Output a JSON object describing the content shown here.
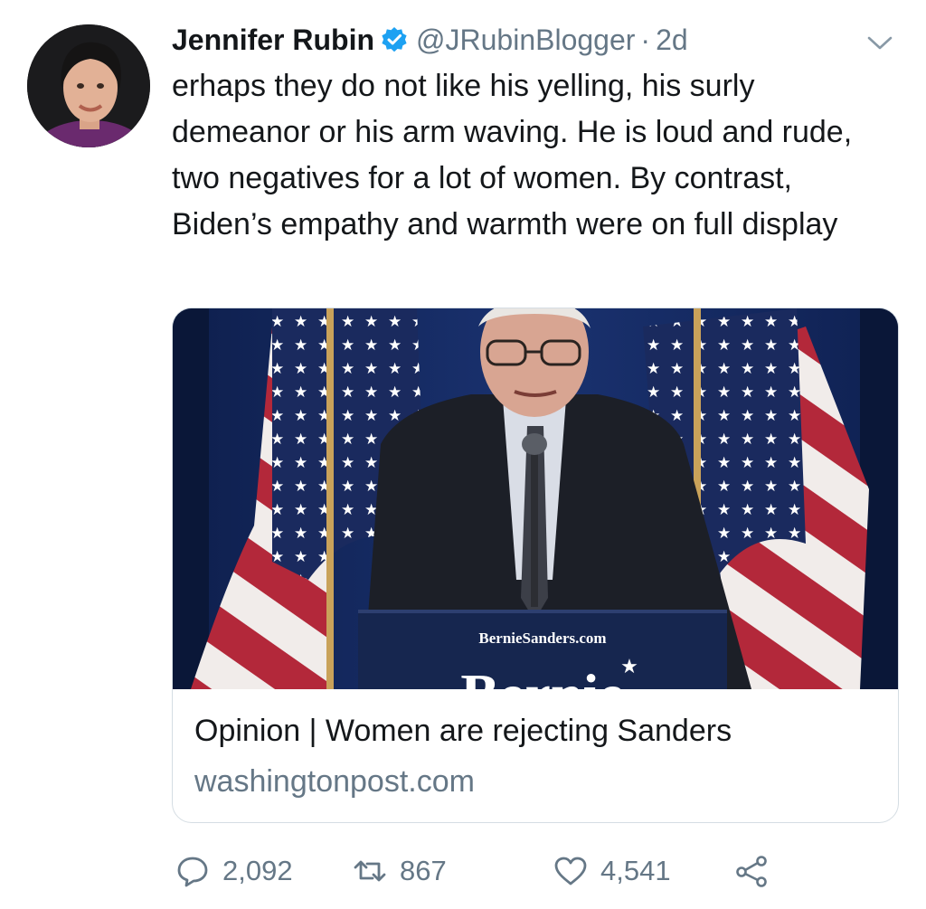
{
  "author": {
    "name": "Jennifer Rubin",
    "handle": "@JRubinBlogger",
    "separator": "·",
    "time": "2d"
  },
  "tweet": {
    "text": "erhaps they do not like his yelling, his surly demeanor or his arm waving. He is loud and rude, two negatives for a lot of women. By contrast, Biden’s empathy and warmth were on full display"
  },
  "card": {
    "title": "Opinion | Women are rejecting Sanders",
    "domain": "washingtonpost.com",
    "image_sign_text": "BernieSanders.com",
    "image_banner_text": "Bernie"
  },
  "stats": {
    "replies": "2,092",
    "retweets": "867",
    "likes": "4,541"
  },
  "icons": {
    "verified": "verified-badge-icon",
    "caret": "chevron-down-icon",
    "reply": "reply-icon",
    "retweet": "retweet-icon",
    "like": "heart-icon",
    "share": "share-icon"
  },
  "colors": {
    "text": "#14171a",
    "secondary": "#657786",
    "verified": "#1da1f2",
    "card_border": "#d5dde3"
  }
}
